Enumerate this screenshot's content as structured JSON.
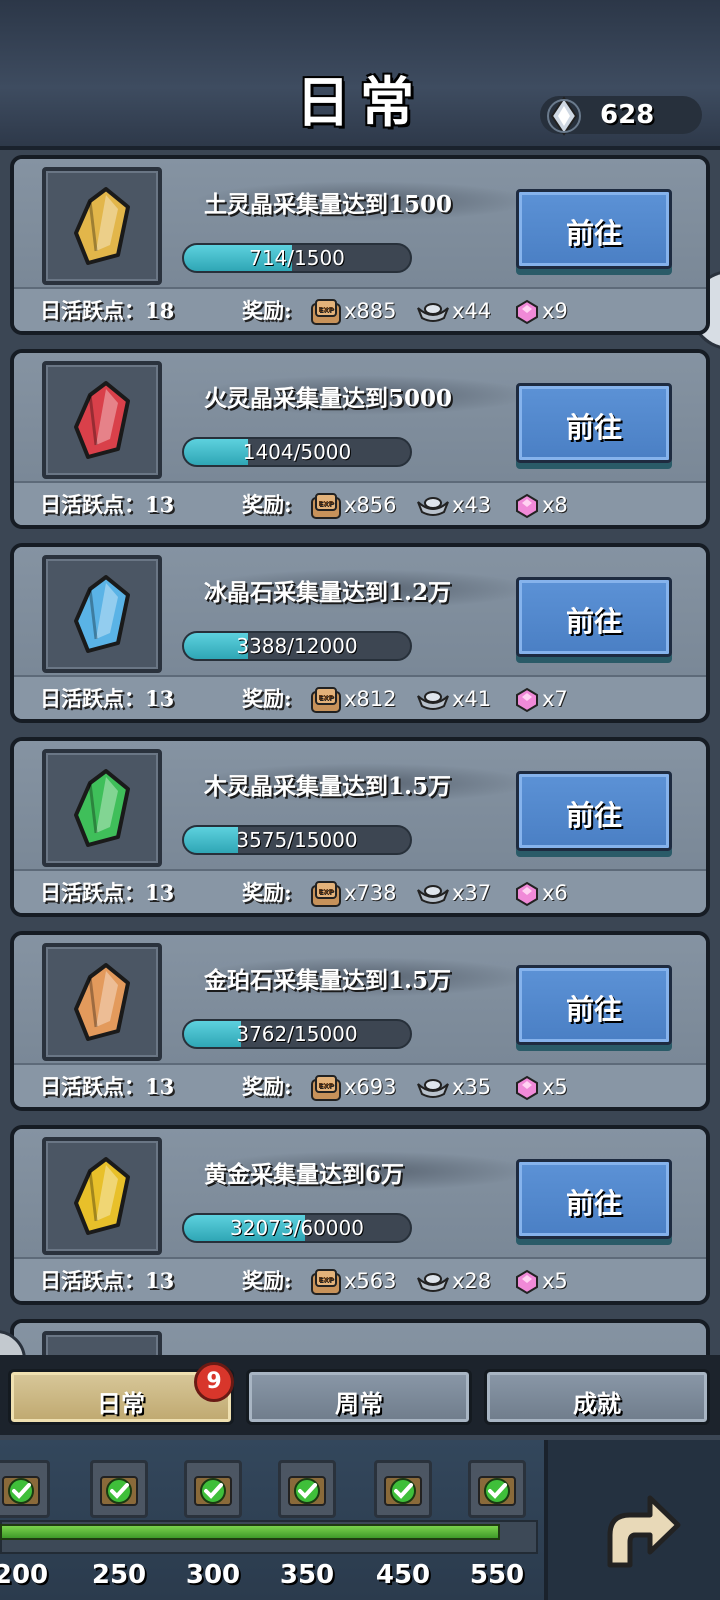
{
  "header": {
    "title": "日常",
    "currency_icon": "diamond-gem-icon",
    "currency_value": "628"
  },
  "tasks": [
    {
      "title": "土灵晶采集量达到1500",
      "progress_text": "714/1500",
      "progress": 0.476,
      "item_icon": "yellow-crystal-icon",
      "item_color": "#e2b64a",
      "button": "前往",
      "active_label": "日活跃点：",
      "active_value": "18",
      "reward_label": "奖励:",
      "exp": "x885",
      "silver": "x44",
      "gem": "x9"
    },
    {
      "title": "火灵晶采集量达到5000",
      "progress_text": "1404/5000",
      "progress": 0.281,
      "item_icon": "red-crystal-icon",
      "item_color": "#d9404a",
      "button": "前往",
      "active_label": "日活跃点：",
      "active_value": "13",
      "reward_label": "奖励:",
      "exp": "x856",
      "silver": "x43",
      "gem": "x8"
    },
    {
      "title": "冰晶石采集量达到1.2万",
      "progress_text": "3388/12000",
      "progress": 0.282,
      "item_icon": "blue-crystal-icon",
      "item_color": "#5ab3e6",
      "button": "前往",
      "active_label": "日活跃点：",
      "active_value": "13",
      "reward_label": "奖励:",
      "exp": "x812",
      "silver": "x41",
      "gem": "x7"
    },
    {
      "title": "木灵晶采集量达到1.5万",
      "progress_text": "3575/15000",
      "progress": 0.238,
      "item_icon": "green-crystal-icon",
      "item_color": "#3fbf5a",
      "button": "前往",
      "active_label": "日活跃点：",
      "active_value": "13",
      "reward_label": "奖励:",
      "exp": "x738",
      "silver": "x37",
      "gem": "x6"
    },
    {
      "title": "金珀石采集量达到1.5万",
      "progress_text": "3762/15000",
      "progress": 0.251,
      "item_icon": "amber-stone-icon",
      "item_color": "#e39a5c",
      "button": "前往",
      "active_label": "日活跃点：",
      "active_value": "13",
      "reward_label": "奖励:",
      "exp": "x693",
      "silver": "x35",
      "gem": "x5"
    },
    {
      "title": "黄金采集量达到6万",
      "progress_text": "32073/60000",
      "progress": 0.535,
      "item_icon": "gold-ore-icon",
      "item_color": "#e8c02a",
      "button": "前往",
      "active_label": "日活跃点：",
      "active_value": "13",
      "reward_label": "奖励:",
      "exp": "x563",
      "silver": "x28",
      "gem": "x5"
    }
  ],
  "tabs": [
    {
      "label": "日常",
      "active": true
    },
    {
      "label": "周常",
      "active": false
    },
    {
      "label": "成就",
      "active": false
    }
  ],
  "badge_count": "9",
  "milestones": [
    "200",
    "250",
    "300",
    "350",
    "450",
    "550"
  ],
  "milestone_progress": 0.93
}
